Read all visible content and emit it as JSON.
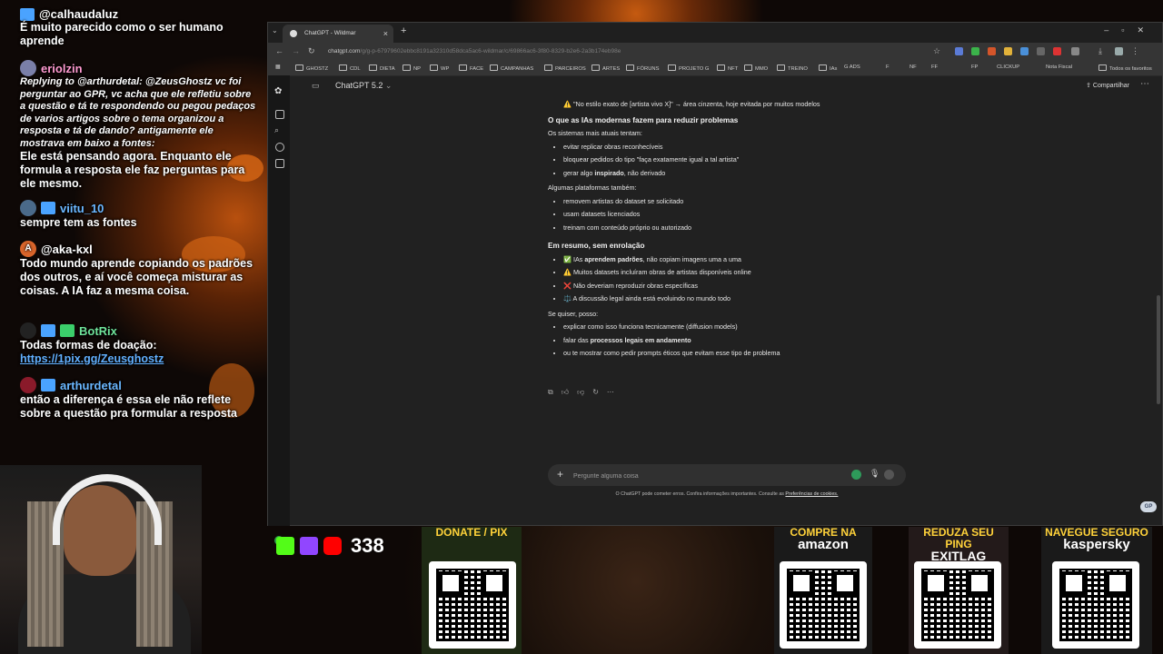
{
  "chat": {
    "m1": {
      "user": "@calhaudaluz",
      "text": "É muito parecido como o ser humano aprende"
    },
    "m2": {
      "user": "eriolzin",
      "reply": "Replying to @arthurdetal: @ZeusGhostz vc foi perguntar ao GPR, vc acha que ele refletiu sobre a questão e tá te respondendo ou pegou pedaços de varios artigos sobre o tema organizou a resposta e tá de dando? antigamente ele mostrava em baixo a fontes:",
      "text": "Ele está pensando agora. Enquanto ele formula a resposta ele faz perguntas para ele mesmo."
    },
    "m3": {
      "user": "viitu_10",
      "text": "sempre tem as fontes"
    },
    "m4": {
      "user": "@aka-kxl",
      "text": "Todo mundo aprende copiando os padrões dos outros, e aí você começa misturar as coisas. A IA faz a mesma coisa."
    },
    "m5": {
      "user": "BotRix",
      "text": "Todas formas de doação:",
      "link": "https://1pix.gg/Zeusghostz"
    },
    "m6": {
      "user": "arthurdetal",
      "text": "então a diferença é essa ele não reflete sobre a questão pra formular a resposta"
    }
  },
  "browser": {
    "tab_title": "ChatGPT - Wildmar",
    "url_host": "chatgpt.com",
    "url_path": "/g/g-p-67979602ebbc8191a32310d58dca5ac6-wildmar/c/69866ac6-3f80-8329-b2e6-2a3b174eb98e",
    "bookmarks": [
      "GHOSTZ",
      "CDL",
      "DIETA",
      "NP",
      "WP",
      "FACE",
      "CAMPANHAS",
      "PARCEIROS",
      "ARTES",
      "FÓRUNS",
      "PROJETO G",
      "NFT",
      "MMO",
      "TREINO",
      "IAs",
      "G ADS",
      "F",
      "NF",
      "FF",
      "FP",
      "CLICKUP",
      "Nota Fiscal",
      "Todos os favoritos"
    ]
  },
  "app": {
    "model": "ChatGPT 5.2",
    "share": "Compartilhar",
    "lines": {
      "top_item": "⚠️ \"No estilo exato de [artista vivo X]\" → área cinzenta, hoje evitada por muitos modelos",
      "h1": "O que as IAs modernas fazem para reduzir problemas",
      "p1": "Os sistemas mais atuais tentam:",
      "l1": [
        "evitar replicar obras reconhecíveis",
        "bloquear pedidos do tipo \"faça exatamente igual a tal artista\""
      ],
      "l1c_pre": "gerar algo ",
      "l1c_bold": "inspirado",
      "l1c_post": ", não derivado",
      "p2": "Algumas plataformas também:",
      "l2": [
        "removem artistas do dataset se solicitado",
        "usam datasets licenciados",
        "treinam com conteúdo próprio ou autorizado"
      ],
      "h2": "Em resumo, sem enrolação",
      "r1_icon": "✅",
      "r1_pre": " IAs ",
      "r1_bold": "aprendem padrões",
      "r1_post": ", não copiam imagens uma a uma",
      "r2": "⚠️ Muitos datasets incluíram obras de artistas disponíveis online",
      "r3": "❌ Não deveriam reproduzir obras específicas",
      "r4": "⚖️ A discussão legal ainda está evoluindo no mundo todo",
      "p3": "Se quiser, posso:",
      "s1": "explicar como isso funciona tecnicamente (diffusion models)",
      "s2_pre": "falar das ",
      "s2_bold": "processos legais em andamento",
      "s3": "ou te mostrar como pedir prompts éticos que evitam esse tipo de problema"
    },
    "composer_placeholder": "Pergunte alguma coisa",
    "disclaimer": "O ChatGPT pode cometer erros. Confira informações importantes. Consulte as",
    "disclaimer_link": "Preferências de cookies."
  },
  "overlay": {
    "viewers": "338",
    "cards": [
      {
        "line1": "DONATE / PIX",
        "line2": ""
      },
      {
        "line1": "COMPRE NA",
        "line2": "amazon"
      },
      {
        "line1": "REDUZA SEU PING",
        "line2": "EXITLAG"
      },
      {
        "line1": "NAVEGUE SEGURO",
        "line2": "kaspersky"
      }
    ]
  },
  "colors": {
    "accent_chat_user": "#62b0ff",
    "brand_yellow": "#ffd23a",
    "browser_bg": "#212121"
  }
}
